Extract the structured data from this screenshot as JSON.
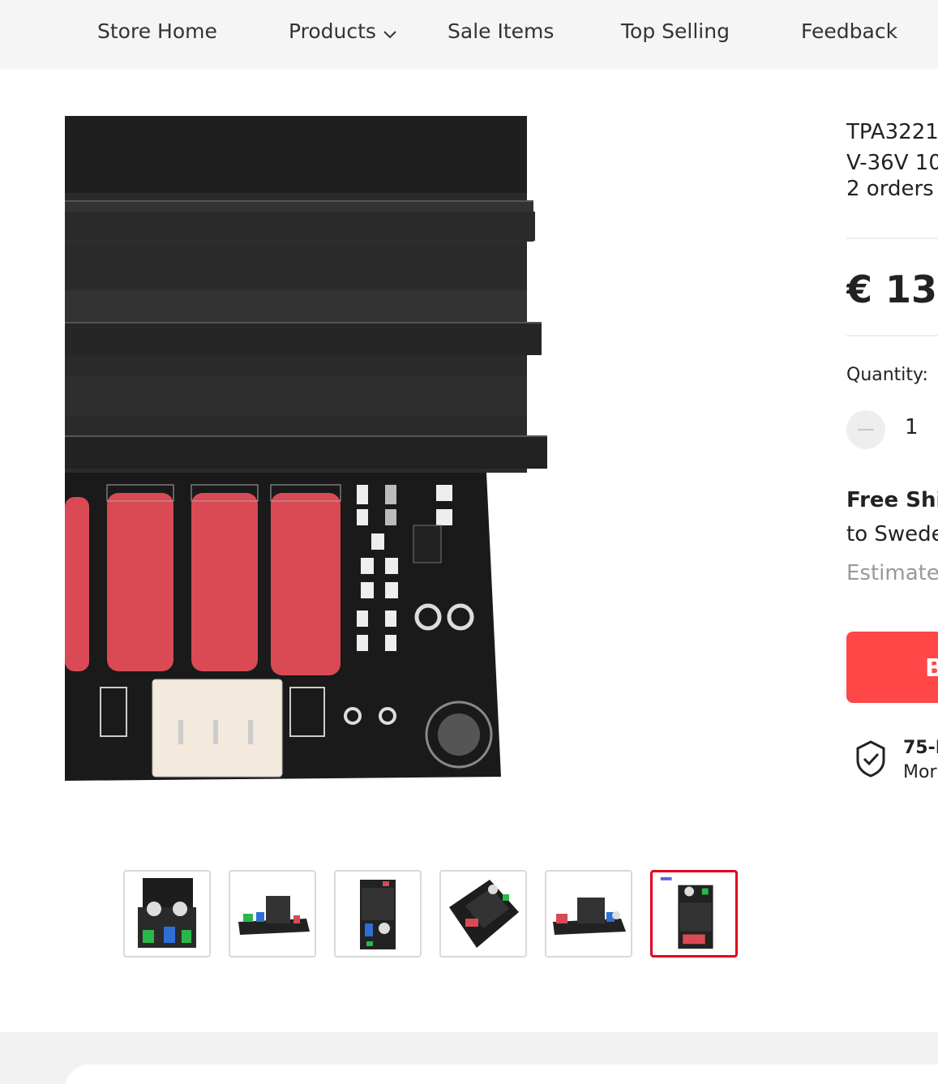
{
  "nav": {
    "items": [
      {
        "label": "Store Home"
      },
      {
        "label": "Products",
        "has_dropdown": true
      },
      {
        "label": "Sale Items"
      },
      {
        "label": "Top Selling"
      },
      {
        "label": "Feedback"
      }
    ]
  },
  "gallery": {
    "main_image": "amplifier-board-closeup",
    "thumbnails": [
      {
        "name": "board-front-view"
      },
      {
        "name": "board-side-view"
      },
      {
        "name": "board-top-view"
      },
      {
        "name": "board-angled-view"
      },
      {
        "name": "board-side-view-2"
      },
      {
        "name": "board-top-view-2",
        "active": true
      }
    ]
  },
  "product": {
    "title_line1": "TPA3221",
    "title_line2": "V-36V 10",
    "orders": "2 orders",
    "price": "€ 13,",
    "quantity_label": "Quantity:",
    "quantity_value": "1",
    "shipping_title": "Free Shi",
    "shipping_to": "to Swede",
    "shipping_estimate": "Estimate",
    "buy_label": "B",
    "guarantee_title": "75-D",
    "guarantee_sub": "Mor"
  },
  "colors": {
    "accent": "#ff4747",
    "active_thumb_border": "#e4001e",
    "nav_bg": "#f5f5f5"
  }
}
